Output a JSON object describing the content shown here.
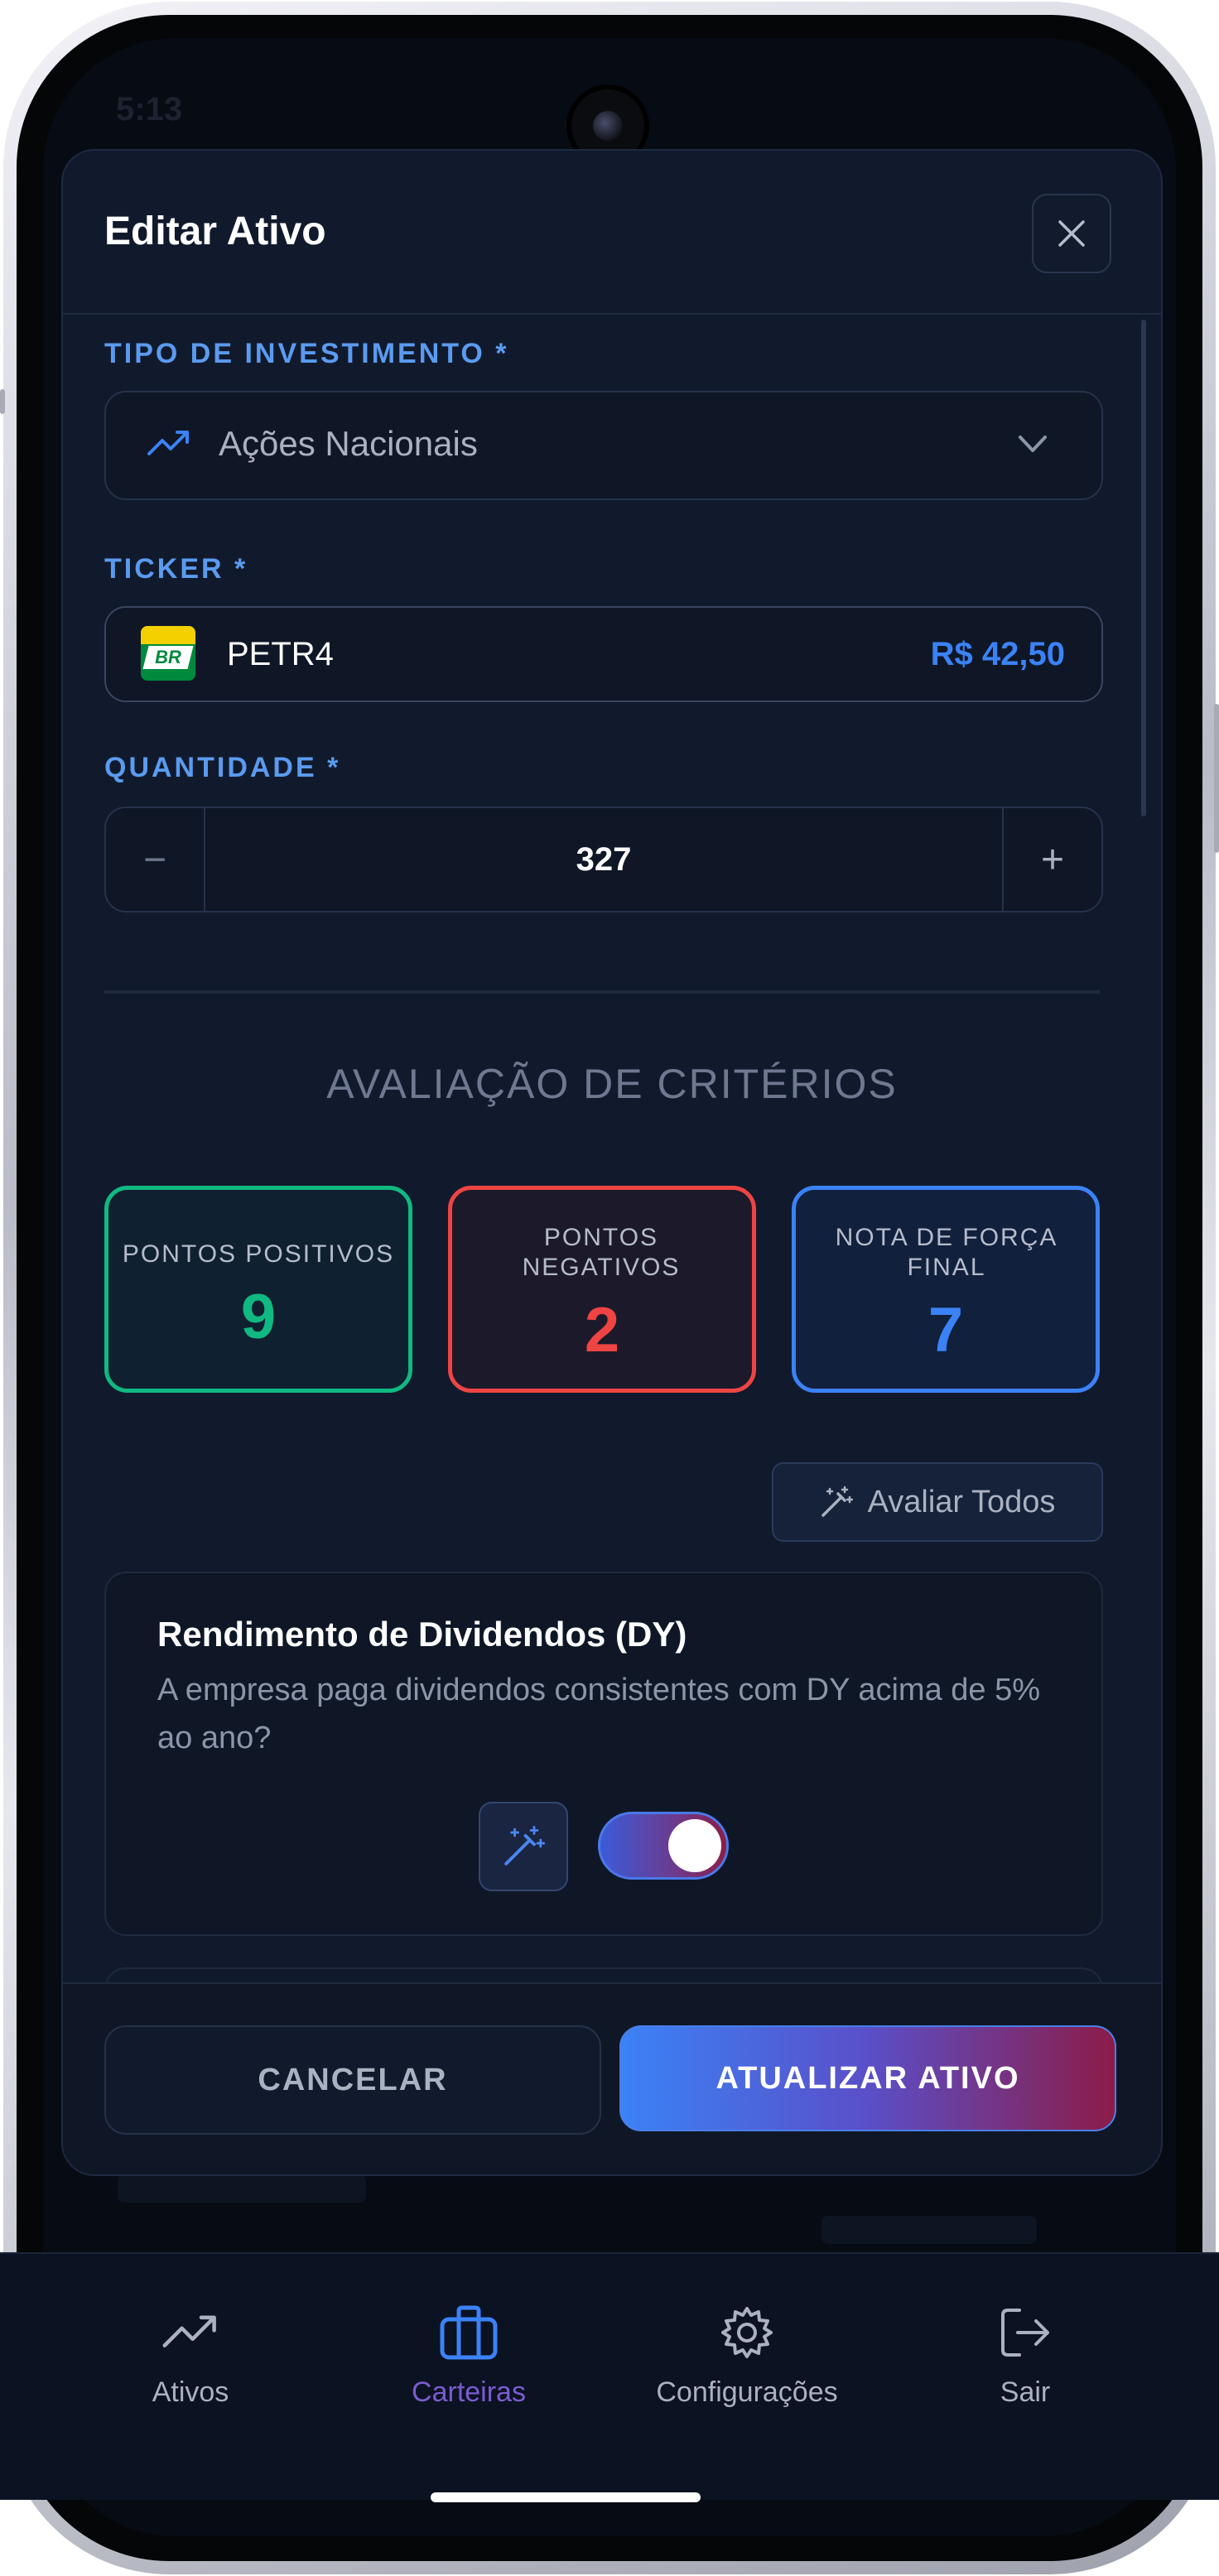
{
  "status_bar": {
    "time": "5:13"
  },
  "modal": {
    "title": "Editar Ativo",
    "investment_type": {
      "label": "TIPO DE INVESTIMENTO *",
      "value": "Ações Nacionais"
    },
    "ticker": {
      "label": "TICKER *",
      "flag_text": "BR",
      "value": "PETR4",
      "price": "R$ 42,50"
    },
    "quantity": {
      "label": "QUANTIDADE *",
      "value": "327",
      "minus": "−",
      "plus": "+"
    },
    "evaluation": {
      "title": "AVALIAÇÃO DE CRITÉRIOS",
      "positive": {
        "label": "PONTOS POSITIVOS",
        "value": "9"
      },
      "negative": {
        "label": "PONTOS NEGATIVOS",
        "value": "2"
      },
      "final": {
        "label": "NOTA DE FORÇA FINAL",
        "value": "7"
      },
      "evaluate_all_label": "Avaliar Todos"
    },
    "criterion": {
      "title": "Rendimento de Dividendos (DY)",
      "description": "A empresa paga dividendos consistentes com DY acima de 5% ao ano?",
      "enabled": true
    },
    "footer": {
      "cancel_label": "CANCELAR",
      "update_label": "ATUALIZAR ATIVO"
    }
  },
  "bottom_nav": {
    "items": [
      {
        "label": "Ativos",
        "icon": "trending-up-icon",
        "active": false
      },
      {
        "label": "Carteiras",
        "icon": "briefcase-icon",
        "active": true
      },
      {
        "label": "Configurações",
        "icon": "gear-icon",
        "active": false
      },
      {
        "label": "Sair",
        "icon": "logout-icon",
        "active": false
      }
    ]
  },
  "colors": {
    "accent": "#3b82f6",
    "positive": "#10b981",
    "negative": "#ef4444",
    "final": "#3b82f6",
    "background": "#111a2c"
  }
}
